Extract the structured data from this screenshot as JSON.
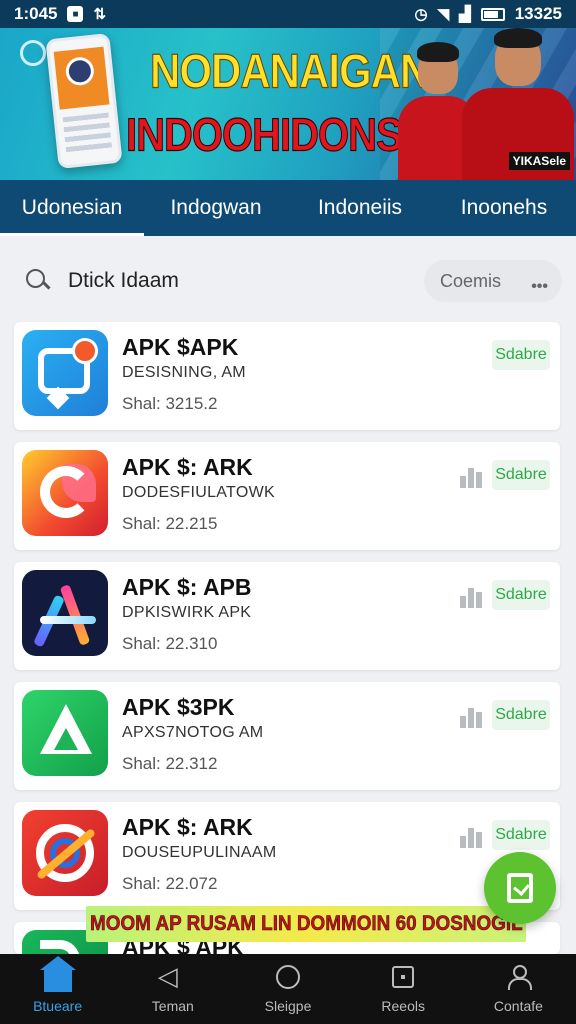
{
  "status_bar": {
    "time": "1:045",
    "clock_right": "13325",
    "icons": [
      "notification-icon",
      "usb-icon",
      "alarm-icon",
      "wifi-icon",
      "signal-icon",
      "battery-icon"
    ]
  },
  "banner": {
    "title": "NODANAIGAN",
    "subtitle": "INDOOHIDONSIA",
    "tag": "YIKASele"
  },
  "tabs": [
    {
      "label": "Udonesian",
      "active": true
    },
    {
      "label": "Indogwan",
      "active": false
    },
    {
      "label": "Indoneiis",
      "active": false
    },
    {
      "label": "Inoonehs",
      "active": false
    }
  ],
  "search": {
    "value": "Dtick Idaam",
    "filter_label": "Coemis",
    "filter_more": "•••"
  },
  "apps": [
    {
      "title": "APK $APK",
      "subtitle": "DESISNING, AM",
      "meta": "Shal: 3215.2",
      "action": "Sdabre",
      "icon": "chat-bubble-icon",
      "show_bars": false
    },
    {
      "title": "APK $: ARK",
      "subtitle": "DODESFIULATOWK",
      "meta": "Shal: 22.215",
      "action": "Sdabre",
      "icon": "g-leaf-icon",
      "show_bars": true
    },
    {
      "title": "APK $: APB",
      "subtitle": "DPKISWIRK APK",
      "meta": "Shal: 22.310",
      "action": "Sdabre",
      "icon": "star-a-icon",
      "show_bars": true
    },
    {
      "title": "APK $3PK",
      "subtitle": "APXS7NOTOG AM",
      "meta": "Shal: 22.312",
      "action": "Sdabre",
      "icon": "triangle-icon",
      "show_bars": true
    },
    {
      "title": "APK $: ARK",
      "subtitle": "DOUSEUPULINAAM",
      "meta": "Shal: 22.072",
      "action": "Sdabre",
      "icon": "target-arrow-icon",
      "show_bars": true
    },
    {
      "title": "APK $ APK",
      "subtitle": "",
      "meta": "",
      "action": "",
      "icon": "d-logo-icon",
      "show_bars": false
    }
  ],
  "promo": {
    "text": "MOOM AP RUSAM LIN DOMMOIN 60 DOSNOGIL"
  },
  "bottom_nav": [
    {
      "label": "Btueare",
      "icon": "home-icon",
      "active": true
    },
    {
      "label": "Teman",
      "icon": "back-icon",
      "active": false
    },
    {
      "label": "Sleigpe",
      "icon": "circle-icon",
      "active": false
    },
    {
      "label": "Reeols",
      "icon": "square-icon",
      "active": false
    },
    {
      "label": "Contafe",
      "icon": "person-icon",
      "active": false
    }
  ],
  "colors": {
    "header_bg": "#0e4a73",
    "status_bg": "#0c3a5a",
    "save_green": "#2ea84a",
    "fab_green": "#5cc22f",
    "nav_active": "#3aa0e8",
    "title_yellow": "#ffe02a",
    "subtitle_red": "#e0161f"
  }
}
